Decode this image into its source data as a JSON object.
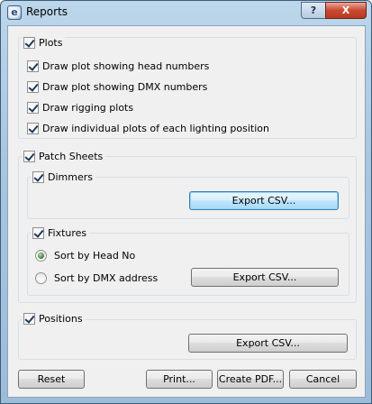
{
  "window": {
    "title": "Reports",
    "help_label": "?",
    "close_label": "X",
    "app_icon_label": "e"
  },
  "plots": {
    "label": "Plots",
    "options": [
      {
        "label": "Draw plot showing head numbers",
        "checked": true
      },
      {
        "label": "Draw plot showing DMX numbers",
        "checked": true
      },
      {
        "label": "Draw rigging plots",
        "checked": true
      },
      {
        "label": "Draw individual plots of each lighting position",
        "checked": true
      }
    ]
  },
  "patch_sheets": {
    "label": "Patch Sheets",
    "dimmers": {
      "label": "Dimmers",
      "export_label": "Export CSV..."
    },
    "fixtures": {
      "label": "Fixtures",
      "sort_head": "Sort by Head No",
      "sort_dmx": "Sort by DMX address",
      "selected_sort": "Sort by Head No",
      "export_label": "Export CSV..."
    }
  },
  "positions": {
    "label": "Positions",
    "export_label": "Export CSV..."
  },
  "footer": {
    "reset": "Reset",
    "print": "Print...",
    "create_pdf": "Create PDF...",
    "cancel": "Cancel"
  }
}
